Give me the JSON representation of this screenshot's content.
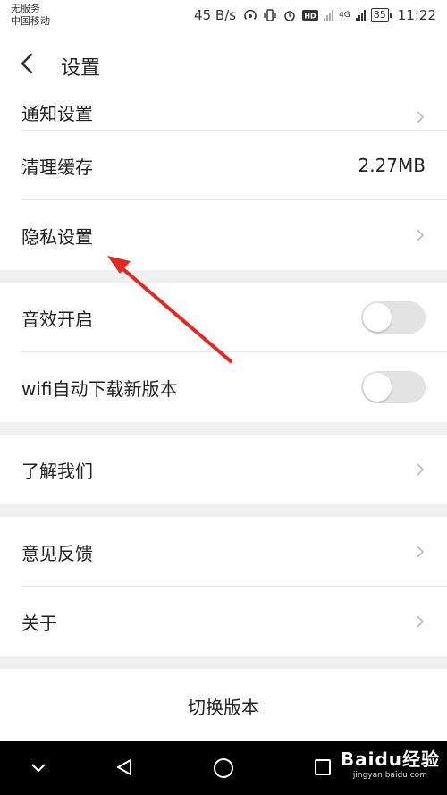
{
  "status_bar": {
    "carrier_line1": "无服务",
    "carrier_line2": "中国移动",
    "speed": "45 B/s",
    "network": "4G",
    "battery": "85",
    "time": "11:22"
  },
  "header": {
    "title": "设置"
  },
  "settings": {
    "partial_item": "通知设置",
    "clear_cache": {
      "label": "清理缓存",
      "value": "2.27MB"
    },
    "privacy": {
      "label": "隐私设置"
    },
    "sound": {
      "label": "音效开启",
      "enabled": false
    },
    "wifi_download": {
      "label": "wifi自动下载新版本",
      "enabled": false
    },
    "about_us": {
      "label": "了解我们"
    },
    "feedback": {
      "label": "意见反馈"
    },
    "about": {
      "label": "关于"
    },
    "switch_version": {
      "label": "切换版本"
    }
  },
  "watermark": {
    "logo": "Baidu经验",
    "url": "jingyan.baidu.com"
  },
  "colors": {
    "annotation_arrow": "#e8251f",
    "toggle_off": "#e3e3e3",
    "section_gap": "#f0f0f0"
  }
}
